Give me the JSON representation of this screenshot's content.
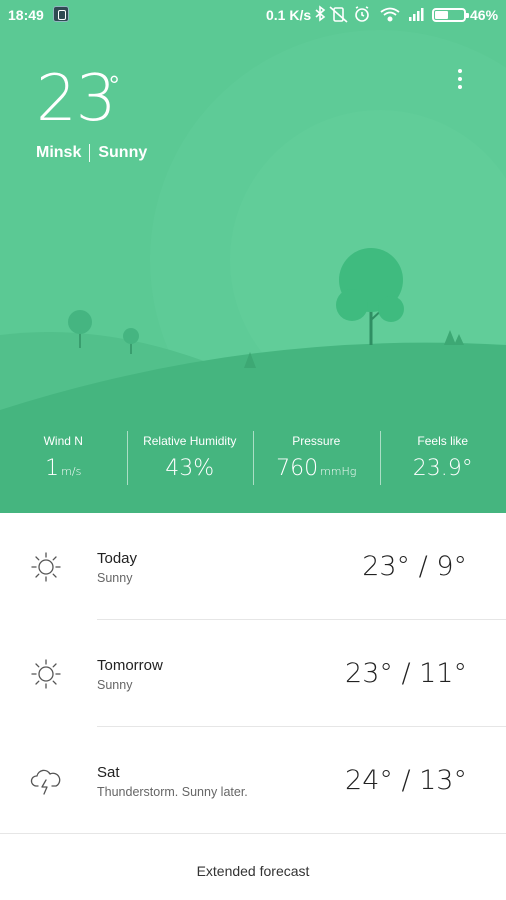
{
  "status_bar": {
    "time": "18:49",
    "speed": "0.1 K/s",
    "battery_percent": "46%",
    "battery_level": 0.46,
    "icons": [
      "app-notification-icon",
      "bluetooth-icon",
      "vibrate-off-icon",
      "alarm-icon",
      "wifi-icon",
      "signal-icon",
      "battery-icon"
    ]
  },
  "current": {
    "temperature": "23",
    "degree": "°",
    "city": "Minsk",
    "condition": "Sunny"
  },
  "metrics": [
    {
      "label": "Wind N",
      "value": "1",
      "unit": "m/s"
    },
    {
      "label": "Relative Humidity",
      "value": "43%",
      "unit": ""
    },
    {
      "label": "Pressure",
      "value": "760",
      "unit": "mmHg"
    },
    {
      "label": "Feels like",
      "value": "23.9°",
      "unit": ""
    }
  ],
  "forecast": [
    {
      "day": "Today",
      "description": "Sunny",
      "temps": "23° / 9°",
      "icon": "sun-icon"
    },
    {
      "day": "Tomorrow",
      "description": "Sunny",
      "temps": "23° / 11°",
      "icon": "sun-icon"
    },
    {
      "day": "Sat",
      "description": "Thunderstorm. Sunny later.",
      "temps": "24° / 13°",
      "icon": "thunderstorm-icon"
    }
  ],
  "extended_label": "Extended forecast",
  "colors": {
    "sky": "#5bc994",
    "hill_back": "#52c08b",
    "hill_front": "#42b07c",
    "tree": "#3fbb7f"
  }
}
